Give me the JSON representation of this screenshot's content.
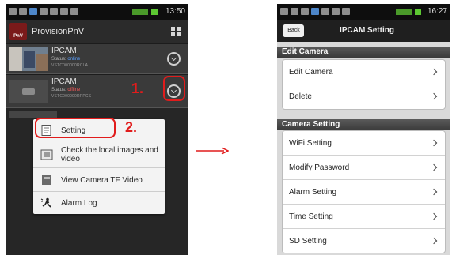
{
  "left_phone": {
    "status_time": "13:50",
    "app_title": "ProvisionPnV",
    "logo_text": "PnV",
    "cameras": [
      {
        "name": "IPCAM",
        "status_label": "Status:",
        "status_value": "online",
        "id": "VSTC000000RCLA"
      },
      {
        "name": "IPCAM",
        "status_label": "Status:",
        "status_value": "offline",
        "id": "VSTC000000RPPCS"
      }
    ],
    "menu": [
      {
        "label": "Setting",
        "icon": "settings-document-icon"
      },
      {
        "label": "Check the local images and video",
        "icon": "film-icon"
      },
      {
        "label": "View Camera TF Video",
        "icon": "card-icon"
      },
      {
        "label": "Alarm Log",
        "icon": "alarm-running-icon"
      }
    ],
    "step1": "1.",
    "step2": "2."
  },
  "right_phone": {
    "status_time": "16:27",
    "back_label": "Back",
    "title": "IPCAM Setting",
    "sections": [
      {
        "header": "Edit Camera",
        "items": [
          "Edit Camera",
          "Delete"
        ]
      },
      {
        "header": "Camera Setting",
        "items": [
          "WiFi Setting",
          "Modify Password",
          "Alarm Setting",
          "Time Setting",
          "SD Setting"
        ]
      }
    ]
  },
  "colors": {
    "annotation_red": "#e11c1c",
    "status_online": "#5aa0ff",
    "status_offline": "#ff5a5a"
  }
}
